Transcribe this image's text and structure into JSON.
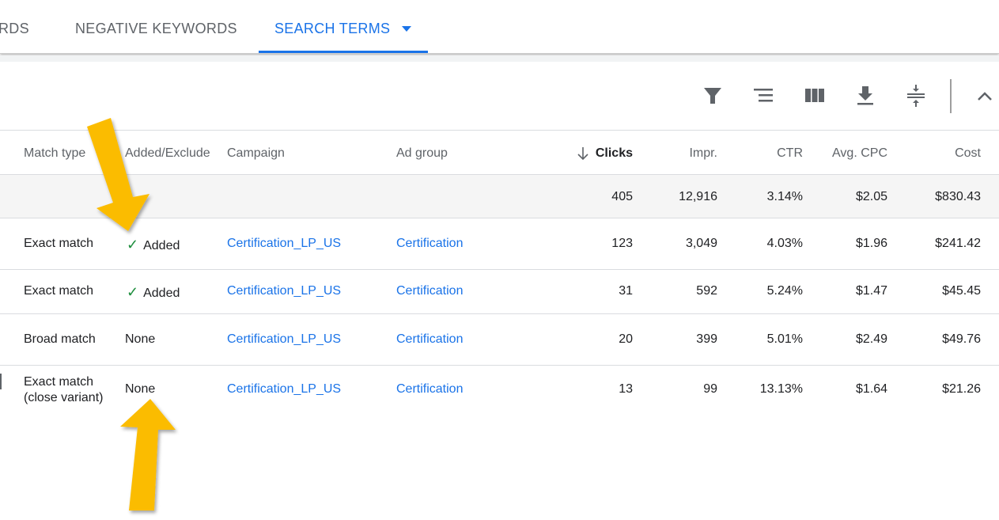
{
  "tabs": [
    {
      "label": "RDS"
    },
    {
      "label": "NEGATIVE KEYWORDS"
    },
    {
      "label": "SEARCH TERMS",
      "active": true
    }
  ],
  "toolbar": {
    "icons": [
      "filter-icon",
      "segment-icon",
      "columns-icon",
      "download-icon",
      "expand-collapse-icon",
      "chevron-up-icon"
    ]
  },
  "columns": {
    "match_type": "Match type",
    "added": "Added/Exclude",
    "campaign": "Campaign",
    "ad_group": "Ad group",
    "clicks": "Clicks",
    "impr": "Impr.",
    "ctr": "CTR",
    "cpc": "Avg. CPC",
    "cost": "Cost"
  },
  "sort": {
    "column": "Clicks",
    "direction": "descending"
  },
  "totals": {
    "clicks": "405",
    "impr": "12,916",
    "ctr": "3.14%",
    "cpc": "$2.05",
    "cost": "$830.43"
  },
  "rows": [
    {
      "match_type": "Exact match",
      "added": "Added",
      "campaign": "Certification_LP_US",
      "ad_group": "Certification",
      "clicks": "123",
      "impr": "3,049",
      "ctr": "4.03%",
      "cpc": "$1.96",
      "cost": "$241.42"
    },
    {
      "match_type": "Exact match",
      "added": "Added",
      "campaign": "Certification_LP_US",
      "ad_group": "Certification",
      "clicks": "31",
      "impr": "592",
      "ctr": "5.24%",
      "cpc": "$1.47",
      "cost": "$45.45"
    },
    {
      "match_type": "Broad match",
      "added": "None",
      "campaign": "Certification_LP_US",
      "ad_group": "Certification",
      "clicks": "20",
      "impr": "399",
      "ctr": "5.01%",
      "cpc": "$2.49",
      "cost": "$49.76"
    },
    {
      "match_type": "Exact match",
      "match_type_2": "(close variant)",
      "added": "None",
      "campaign": "Certification_LP_US",
      "ad_group": "Certification",
      "clicks": "13",
      "impr": "99",
      "ctr": "13.13%",
      "cpc": "$1.64",
      "cost": "$21.26"
    }
  ],
  "colors": {
    "accent": "#1a73e8",
    "check": "#1e8e3e",
    "annotation_arrow": "#fbbc04"
  }
}
